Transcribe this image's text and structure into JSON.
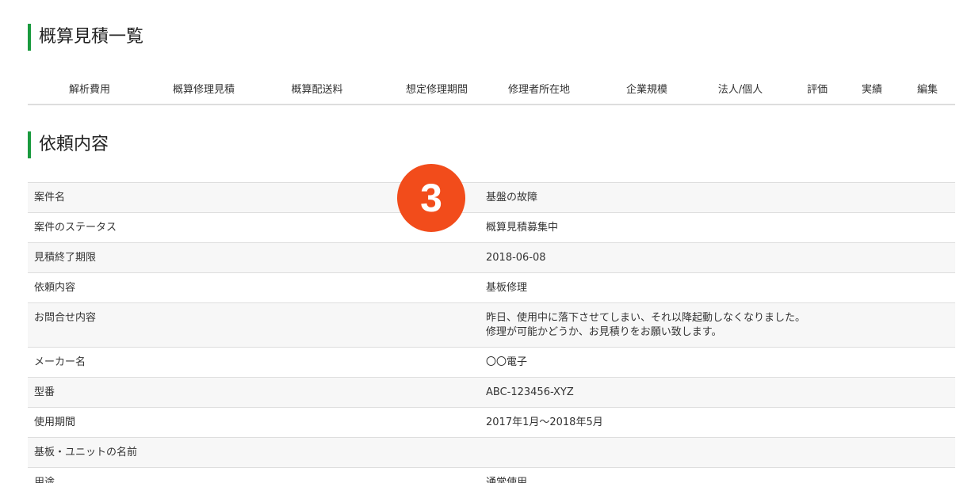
{
  "estimates": {
    "title": "概算見積一覧",
    "columns": [
      "解析費用",
      "概算修理見積",
      "概算配送料",
      "想定修理期間",
      "修理者所在地",
      "企業規模",
      "法人/個人",
      "評価",
      "実績",
      "編集"
    ]
  },
  "request": {
    "title": "依頼内容",
    "rows": [
      {
        "label": "案件名",
        "value": "基盤の故障"
      },
      {
        "label": "案件のステータス",
        "value": "概算見積募集中"
      },
      {
        "label": "見積終了期限",
        "value": "2018-06-08"
      },
      {
        "label": "依頼内容",
        "value": "基板修理"
      },
      {
        "label": "お問合せ内容",
        "value": "昨日、使用中に落下させてしまい、それ以降起動しなくなりました。",
        "value2": "修理が可能かどうか、お見積りをお願い致します。"
      },
      {
        "label": "メーカー名",
        "value": "〇〇電子"
      },
      {
        "label": "型番",
        "value": "ABC-123456-XYZ"
      },
      {
        "label": "使用期間",
        "value": "2017年1月〜2018年5月"
      },
      {
        "label": "基板・ユニットの名前",
        "value": ""
      },
      {
        "label": "用途",
        "value": "通常使用"
      }
    ]
  },
  "badge": {
    "number": "3",
    "color": "#f24c1b"
  },
  "colors": {
    "accent": "#1a9a3e"
  }
}
